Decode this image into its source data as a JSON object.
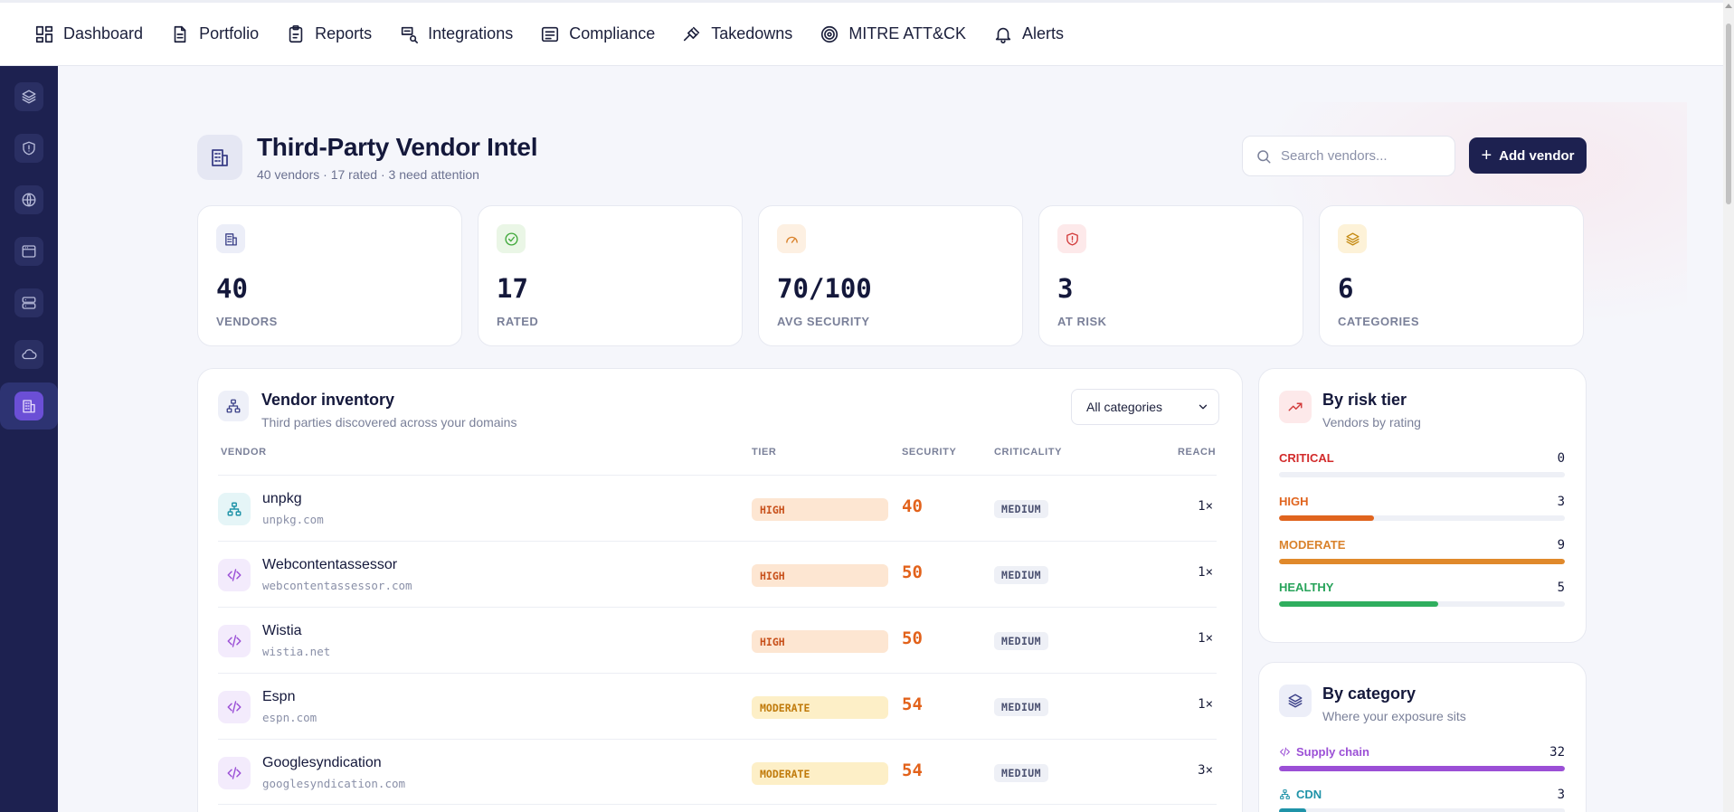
{
  "nav": {
    "items": [
      {
        "label": "Dashboard",
        "icon": "dashboard-icon"
      },
      {
        "label": "Portfolio",
        "icon": "portfolio-icon"
      },
      {
        "label": "Reports",
        "icon": "reports-icon"
      },
      {
        "label": "Integrations",
        "icon": "integrations-icon"
      },
      {
        "label": "Compliance",
        "icon": "compliance-icon"
      },
      {
        "label": "Takedowns",
        "icon": "gavel-icon"
      },
      {
        "label": "MITRE ATT&CK",
        "icon": "target-icon"
      },
      {
        "label": "Alerts",
        "icon": "bell-icon"
      }
    ]
  },
  "sidebar": {
    "items": [
      {
        "icon": "layers-icon"
      },
      {
        "icon": "shield-icon"
      },
      {
        "icon": "globe-icon"
      },
      {
        "icon": "browser-window-icon"
      },
      {
        "icon": "server-icon"
      },
      {
        "icon": "cloud-icon"
      },
      {
        "icon": "building-icon",
        "active": true
      }
    ]
  },
  "header": {
    "title": "Third-Party Vendor Intel",
    "subtitle": "40 vendors · 17 rated · 3 need attention",
    "search_placeholder": "Search vendors...",
    "add_label": "Add vendor"
  },
  "stats": [
    {
      "value": "40",
      "label": "VENDORS",
      "icon": "building-icon",
      "color": "#3b4088",
      "bg": "#eceef8"
    },
    {
      "value": "17",
      "label": "RATED",
      "icon": "check-circle-icon",
      "color": "#3fa83a",
      "bg": "#eaf6e6"
    },
    {
      "value": "70/100",
      "label": "AVG SECURITY",
      "icon": "gauge-icon",
      "color": "#d9822b",
      "bg": "#fdf0e2"
    },
    {
      "value": "3",
      "label": "AT RISK",
      "icon": "shield-alert-icon",
      "color": "#d23b3b",
      "bg": "#fde9ea"
    },
    {
      "value": "6",
      "label": "CATEGORIES",
      "icon": "layers-icon",
      "color": "#c48a12",
      "bg": "#fdf2d8"
    }
  ],
  "inventory": {
    "title": "Vendor inventory",
    "subtitle": "Third parties discovered across your domains",
    "filter_value": "All categories",
    "columns": [
      "VENDOR",
      "TIER",
      "SECURITY",
      "CRITICALITY",
      "REACH"
    ],
    "rows": [
      {
        "name": "unpkg",
        "domain": "unpkg.com",
        "tier": "HIGH",
        "tier_class": "high",
        "security": "40",
        "criticality": "MEDIUM",
        "reach": "1×",
        "icon": "network-icon",
        "icon_color": "#1f93a8",
        "icon_bg": "#e5f5f7"
      },
      {
        "name": "Webcontentassessor",
        "domain": "webcontentassessor.com",
        "tier": "HIGH",
        "tier_class": "high",
        "security": "50",
        "criticality": "MEDIUM",
        "reach": "1×",
        "icon": "code-icon",
        "icon_color": "#9b4fd6",
        "icon_bg": "#f3ebfc"
      },
      {
        "name": "Wistia",
        "domain": "wistia.net",
        "tier": "HIGH",
        "tier_class": "high",
        "security": "50",
        "criticality": "MEDIUM",
        "reach": "1×",
        "icon": "code-icon",
        "icon_color": "#9b4fd6",
        "icon_bg": "#f3ebfc"
      },
      {
        "name": "Espn",
        "domain": "espn.com",
        "tier": "MODERATE",
        "tier_class": "moderate",
        "security": "54",
        "criticality": "MEDIUM",
        "reach": "1×",
        "icon": "code-icon",
        "icon_color": "#9b4fd6",
        "icon_bg": "#f3ebfc"
      },
      {
        "name": "Googlesyndication",
        "domain": "googlesyndication.com",
        "tier": "MODERATE",
        "tier_class": "moderate",
        "security": "54",
        "criticality": "MEDIUM",
        "reach": "3×",
        "icon": "code-icon",
        "icon_color": "#9b4fd6",
        "icon_bg": "#f3ebfc"
      }
    ]
  },
  "risk_tiers": {
    "title": "By risk tier",
    "subtitle": "Vendors by rating",
    "tiers": [
      {
        "label": "CRITICAL",
        "count": "0",
        "fraction": 0,
        "color": "#d22a2a",
        "bar": "#d22a2a"
      },
      {
        "label": "HIGH",
        "count": "3",
        "fraction": 0.333,
        "color": "#e0641e",
        "bar": "#e0641e"
      },
      {
        "label": "MODERATE",
        "count": "9",
        "fraction": 1.0,
        "color": "#d9822b",
        "bar": "#e0892b"
      },
      {
        "label": "HEALTHY",
        "count": "5",
        "fraction": 0.556,
        "color": "#27a35a",
        "bar": "#2fae5e"
      }
    ]
  },
  "categories": {
    "title": "By category",
    "subtitle": "Where your exposure sits",
    "items": [
      {
        "label": "Supply chain",
        "count": "32",
        "fraction": 1.0,
        "color": "#9b4fd6",
        "icon": "code-icon"
      },
      {
        "label": "CDN",
        "count": "3",
        "fraction": 0.094,
        "color": "#1f93a8",
        "icon": "network-icon"
      }
    ]
  }
}
